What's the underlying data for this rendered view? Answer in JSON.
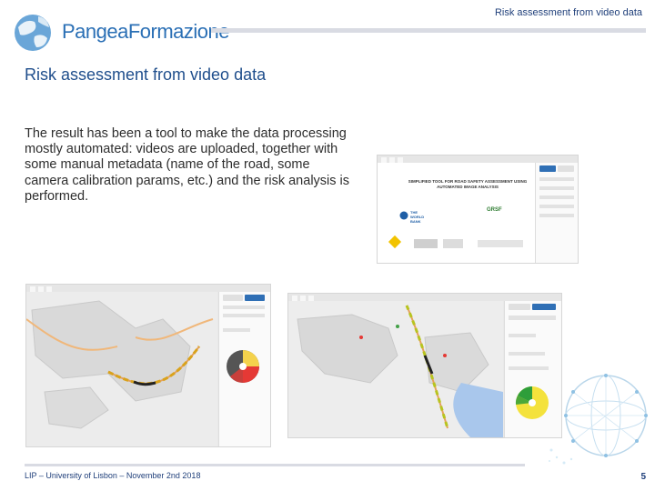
{
  "header": {
    "title": "Risk assessment from video data",
    "logo_text": "PangeaFormazione"
  },
  "slide": {
    "title": "Risk assessment from video data",
    "body": "The result has been a tool to make the data processing mostly automated: videos are uploaded, together with some manual metadata (name of the road, some camera calibration params, etc.) and the risk analysis is performed."
  },
  "screenshots": {
    "top": {
      "doc_title": "SIMPLIFIED TOOL FOR ROAD SAFETY ASSESSMENT USING AUTOMATED IMAGE ANALYSIS",
      "logo1": "THE WORLD BANK",
      "logo2": "GRSF"
    }
  },
  "footer": {
    "text": "LIP – University of Lisbon – November 2nd 2018",
    "page_number": "5"
  },
  "colors": {
    "title_blue": "#1f4e8c",
    "header_blue": "#1f3f7a",
    "rule_gray": "#d9dbe3"
  }
}
